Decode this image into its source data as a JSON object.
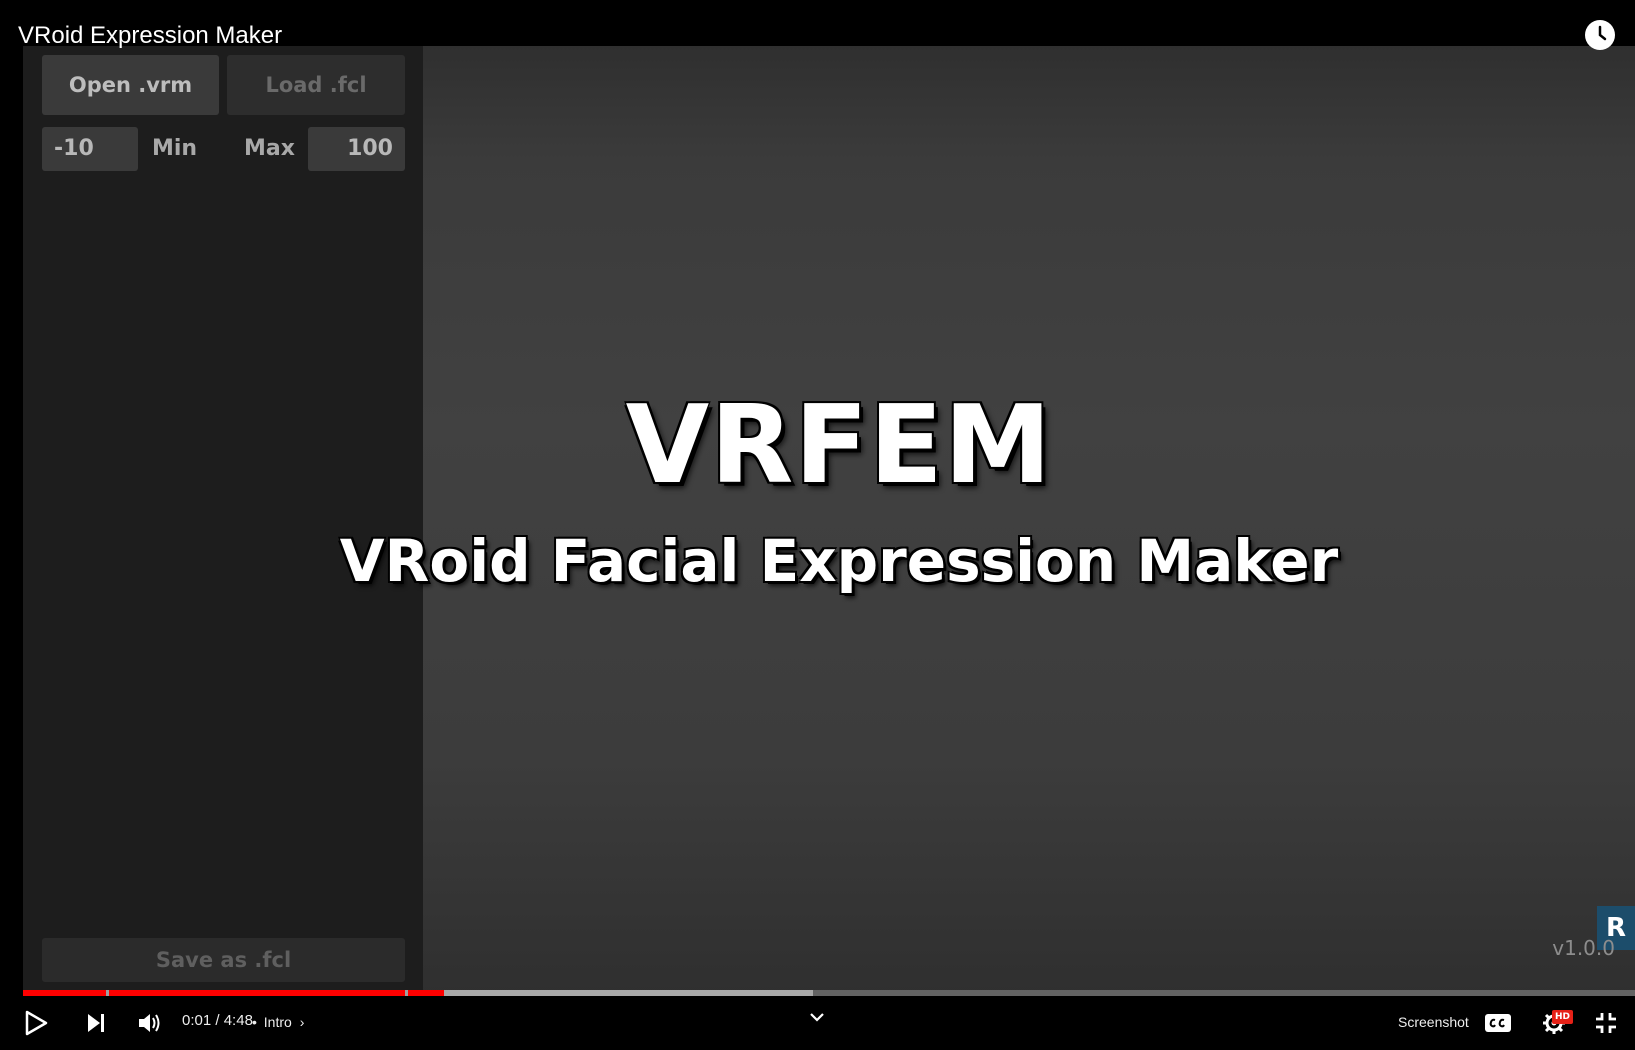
{
  "window": {
    "video_title": "VRoid Expression Maker"
  },
  "top_bar": {
    "watch_later_icon": "clock-icon"
  },
  "app": {
    "buttons": {
      "open": "Open .vrm",
      "load": "Load .fcl",
      "save": "Save as .fcl"
    },
    "range": {
      "min_value": "-10",
      "min_label": "Min",
      "max_label": "Max",
      "max_value": "100"
    },
    "splash": {
      "title": "VRFEM",
      "subtitle": "VRoid Facial Expression Maker"
    },
    "version": "v1.0.0",
    "logo_letter": "R"
  },
  "player": {
    "current_time": "0:01",
    "separator": "/",
    "duration": "4:48",
    "chapter_dot": "•",
    "chapter": "Intro",
    "screenshot_label": "Screenshot",
    "hd_badge": "HD",
    "accent_color": "#ff0000",
    "icons": [
      "play-icon",
      "next-icon",
      "volume-icon",
      "chevron-down-icon",
      "captions-icon",
      "settings-icon",
      "exit-fullscreen-icon"
    ]
  }
}
